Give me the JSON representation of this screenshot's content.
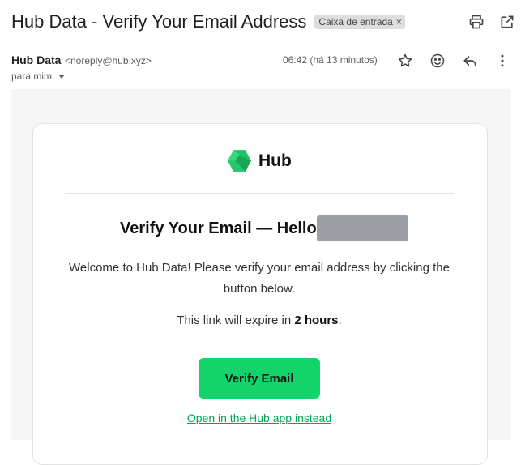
{
  "header": {
    "subject": "Hub Data - Verify Your Email Address",
    "label": "Caixa de entrada",
    "label_close": "×",
    "icons": [
      "print-icon",
      "open-in-new-window-icon"
    ]
  },
  "sender": {
    "name": "Hub Data",
    "email": "<noreply@hub.xyz>",
    "time": "06:42 (há 13 minutos)",
    "recipient": "para mim",
    "actions": [
      "star-icon",
      "emoji-reaction-icon",
      "reply-icon",
      "more-options-icon"
    ]
  },
  "email": {
    "brand": "Hub",
    "brand_color": "#1fc264",
    "heading": "Verify Your Email — Hello",
    "welcome_text": "Welcome to Hub Data! Please verify your email address by clicking the button below.",
    "expire_prefix": "This link will expire in ",
    "expire_value": "2 hours",
    "expire_suffix": ".",
    "button_label": "Verify Email",
    "button_color": "#12d46a",
    "app_link": "Open in the Hub app instead"
  }
}
